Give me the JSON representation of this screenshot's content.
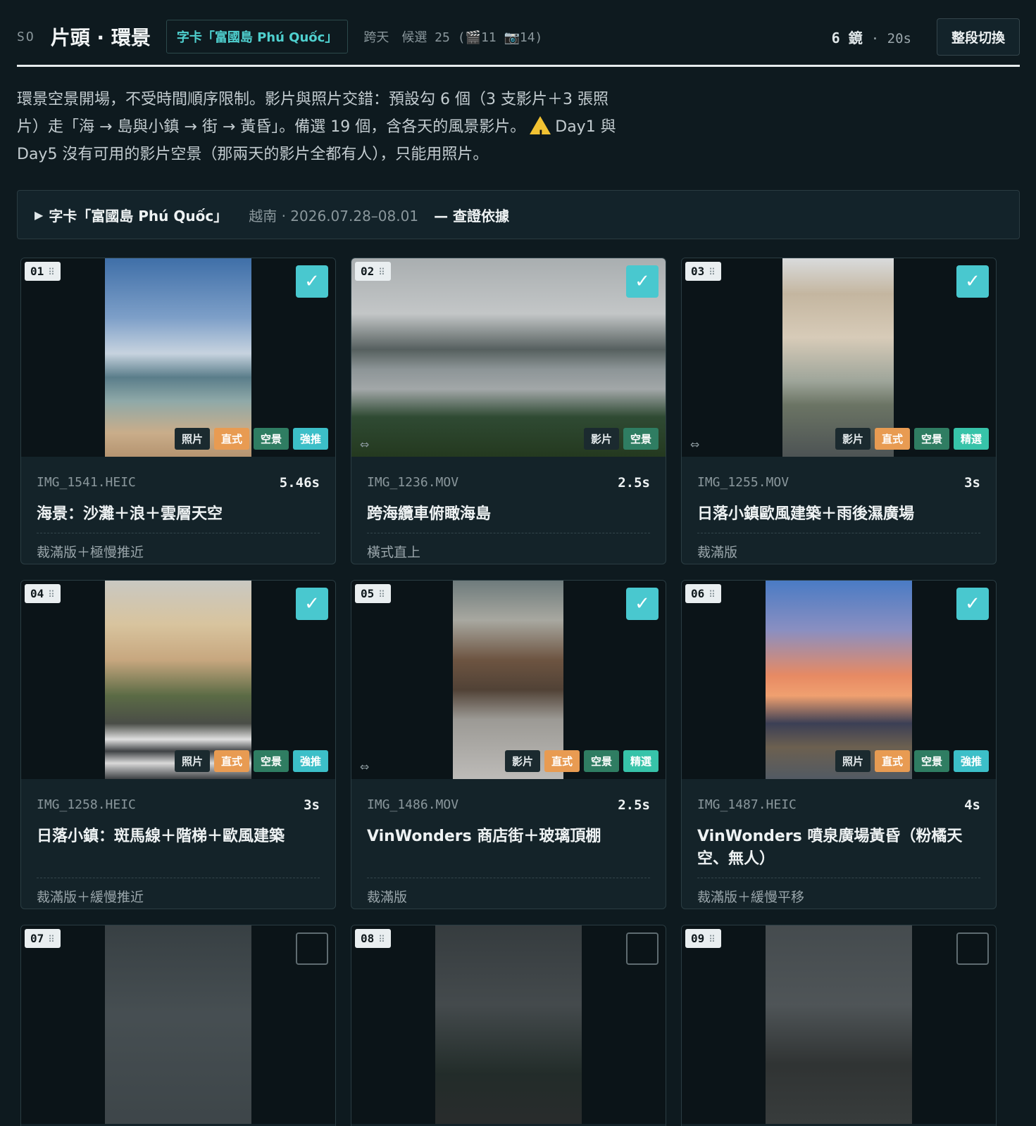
{
  "header": {
    "code": "SO",
    "title": "片頭 · 環景",
    "chip": "字卡「富國島 Phú Quốc」",
    "meta": "跨天　候選 25 (🎬11 📷14)",
    "shots_count": "6 鏡",
    "shots_duration": "· 20s",
    "switch_label": "整段切換"
  },
  "description": {
    "line1": "環景空景開場，不受時間順序限制。影片與照片交錯：預設勾 6 個（3 支影片＋3 張照",
    "line2": "片）走「海 → 島與小鎮 → 街 → 黃昏」。備選 19 個，含各天的風景影片。",
    "warn_text": "Day1 與",
    "line3": "Day5 沒有可用的影片空景（那兩天的影片全都有人），只能用照片。"
  },
  "evidence": {
    "title": "字卡「富國島 Phú Quốc」",
    "meta": "越南 · 2026.07.28–08.01",
    "link": "— 查證依據"
  },
  "cards": [
    {
      "num": "01",
      "checked": true,
      "file": "IMG_1541.HEIC",
      "duration": "5.46s",
      "title": "海景：沙灘＋浪＋雲層天空",
      "note": "裁滿版＋極慢推近",
      "tags": [
        "照片",
        "直式",
        "空景",
        "強推"
      ]
    },
    {
      "num": "02",
      "checked": true,
      "file": "IMG_1236.MOV",
      "duration": "2.5s",
      "title": "跨海纜車俯瞰海島",
      "note": "橫式直上",
      "tags": [
        "影片",
        "空景"
      ]
    },
    {
      "num": "03",
      "checked": true,
      "file": "IMG_1255.MOV",
      "duration": "3s",
      "title": "日落小鎮歐風建築＋雨後濕廣場",
      "note": "裁滿版",
      "tags": [
        "影片",
        "直式",
        "空景",
        "精選"
      ]
    },
    {
      "num": "04",
      "checked": true,
      "file": "IMG_1258.HEIC",
      "duration": "3s",
      "title": "日落小鎮：斑馬線＋階梯＋歐風建築",
      "note": "裁滿版＋緩慢推近",
      "tags": [
        "照片",
        "直式",
        "空景",
        "強推"
      ]
    },
    {
      "num": "05",
      "checked": true,
      "file": "IMG_1486.MOV",
      "duration": "2.5s",
      "title": "VinWonders 商店街＋玻璃頂棚",
      "note": "裁滿版",
      "tags": [
        "影片",
        "直式",
        "空景",
        "精選"
      ]
    },
    {
      "num": "06",
      "checked": true,
      "file": "IMG_1487.HEIC",
      "duration": "4s",
      "title": "VinWonders 噴泉廣場黃昏（粉橘天空、無人）",
      "note": "裁滿版＋緩慢平移",
      "tags": [
        "照片",
        "直式",
        "空景",
        "強推"
      ]
    },
    {
      "num": "07",
      "checked": false
    },
    {
      "num": "08",
      "checked": false
    },
    {
      "num": "09",
      "checked": false
    }
  ],
  "icons": {
    "check": "check-icon",
    "drag": "drag-handle-icon",
    "swap": "swap-orientation-icon",
    "warning": "warning-icon",
    "expand": "expand-triangle-icon"
  },
  "colors": {
    "background": "#0e1a1f",
    "accent": "#49c8cf",
    "vertical_tag": "#e89b52",
    "empty_tag": "#2f7d62",
    "recommend_tag": "#3cbfc8"
  }
}
